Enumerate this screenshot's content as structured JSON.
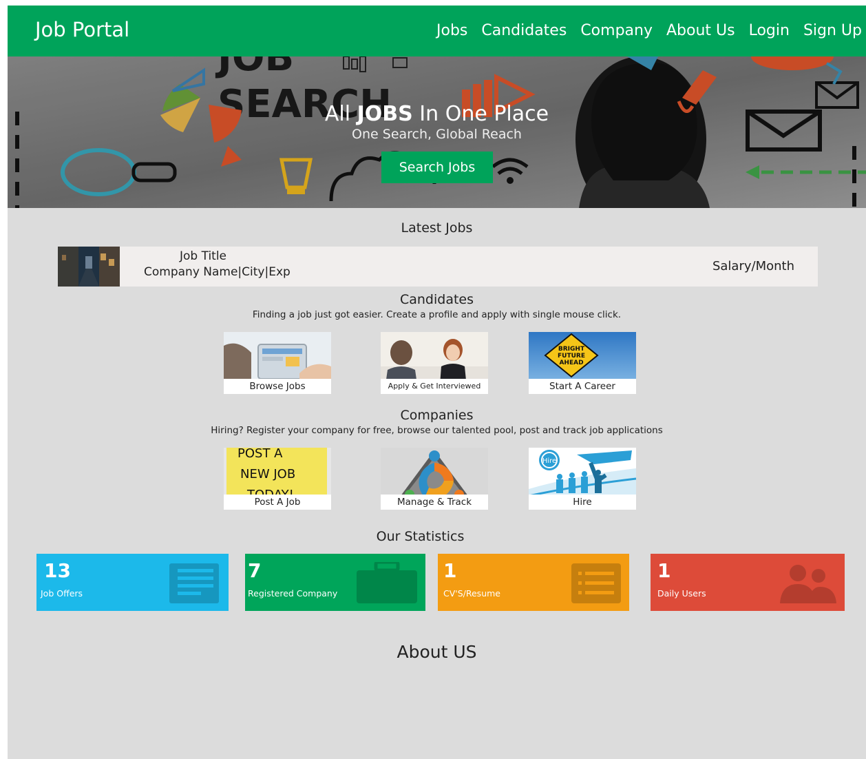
{
  "nav": {
    "brand": "Job Portal",
    "links": [
      "Jobs",
      "Candidates",
      "Company",
      "About Us",
      "Login",
      "Sign Up"
    ]
  },
  "hero": {
    "title_pre": "All ",
    "title_bold": "JOBS",
    "title_post": " In One Place",
    "subtitle": "One Search, Global Reach",
    "button": "Search Jobs",
    "bg_text_1": "JOB",
    "bg_text_2": "SEARCH"
  },
  "latest_jobs": {
    "heading": "Latest Jobs",
    "job": {
      "title": "Job Title",
      "meta": "Company Name|City|Exp",
      "salary": "Salary/Month"
    }
  },
  "candidates": {
    "heading": "Candidates",
    "description": "Finding a job just got easier. Create a profile and apply with single mouse click.",
    "tiles": [
      {
        "label": "Browse Jobs"
      },
      {
        "label": "Apply & Get Interviewed"
      },
      {
        "label": "Start A Career",
        "sign_text": [
          "BRIGHT",
          "FUTURE",
          "AHEAD"
        ]
      }
    ]
  },
  "companies": {
    "heading": "Companies",
    "description": "Hiring? Register your company for free, browse our talented pool, post and track job applications",
    "tiles": [
      {
        "label": "Post A Job",
        "note_text": [
          "POST A",
          "NEW JOB",
          "TODAY!"
        ]
      },
      {
        "label": "Manage & Track"
      },
      {
        "label": "Hire",
        "badge_text": "Hire"
      }
    ]
  },
  "statistics": {
    "heading": "Our Statistics",
    "items": [
      {
        "value": "13",
        "label": "Job Offers",
        "color": "#1cb9ea",
        "icon": "document-icon"
      },
      {
        "value": "7",
        "label": "Registered Company",
        "color": "#00a55a",
        "icon": "briefcase-icon"
      },
      {
        "value": "1",
        "label": "CV'S/Resume",
        "color": "#f39c12",
        "icon": "list-icon"
      },
      {
        "value": "1",
        "label": "Daily Users",
        "color": "#dd4b39",
        "icon": "users-icon"
      }
    ]
  },
  "about": {
    "heading": "About US"
  },
  "colors": {
    "brand_green": "#00a35a",
    "page_bg": "#dcdcdc",
    "job_card_bg": "#f1eeed"
  }
}
